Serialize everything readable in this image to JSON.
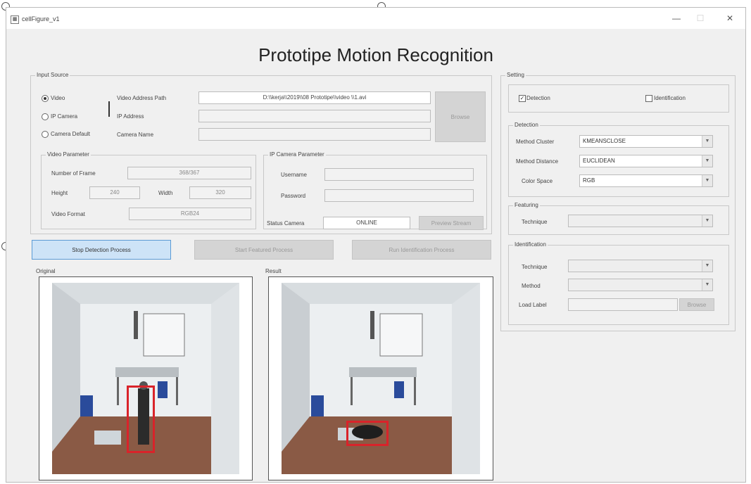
{
  "window": {
    "title": "cellFigure_v1",
    "minimize_icon": "minimize-icon",
    "maximize_icon": "maximize-icon",
    "close_icon": "close-icon"
  },
  "app_title": "Prototipe Motion Recognition",
  "input_source": {
    "title": "Input Source",
    "radios": [
      {
        "label": "Video",
        "checked": true
      },
      {
        "label": "IP Camera",
        "checked": false
      },
      {
        "label": "Camera Default",
        "checked": false
      }
    ],
    "video_path": {
      "label": "Video Address Path",
      "value": "D:\\\\kerja\\\\2019\\\\08 Prototipe\\\\video \\\\1.avi"
    },
    "ip_address": {
      "label": "IP Address",
      "value": ""
    },
    "camera_name": {
      "label": "Camera Name",
      "value": ""
    },
    "browse_label": "Browse"
  },
  "video_parameter": {
    "title": "Video Parameter",
    "frames": {
      "label": "Number of Frame",
      "value": "368/367"
    },
    "height": {
      "label": "Height",
      "value": "240"
    },
    "width": {
      "label": "Width",
      "value": "320"
    },
    "format": {
      "label": "Video Format",
      "value": "RGB24"
    }
  },
  "ip_camera_parameter": {
    "title": "IP Camera Parameter",
    "username": {
      "label": "Username",
      "value": ""
    },
    "password": {
      "label": "Password",
      "value": ""
    },
    "status": {
      "label": "Status Camera",
      "value": "ONLINE"
    },
    "preview_label": "Preview Stream"
  },
  "actions": {
    "detection": "Stop Detection Process",
    "feature": "Start Featured Process",
    "identification": "Run Identification Process"
  },
  "panels": {
    "original": "Original",
    "result": "Result"
  },
  "setting": {
    "title": "Setting",
    "detection_check": {
      "label": "Detection",
      "checked": true
    },
    "identification_check": {
      "label": "Identification",
      "checked": false
    },
    "detection_group": {
      "title": "Detection",
      "method_cluster": {
        "label": "Method Cluster",
        "value": "KMEANSCLOSE"
      },
      "method_distance": {
        "label": "Method Distance",
        "value": "EUCLIDEAN"
      },
      "color_space": {
        "label": "Color Space",
        "value": "RGB"
      }
    },
    "featuring_group": {
      "title": "Featuring",
      "technique": {
        "label": "Technique",
        "value": ""
      }
    },
    "identification_group": {
      "title": "Identification",
      "technique": {
        "label": "Technique",
        "value": ""
      },
      "method": {
        "label": "Method",
        "value": ""
      },
      "load_label": {
        "label": "Load Label",
        "value": "",
        "button": "Browse"
      }
    }
  },
  "colors": {
    "accent": "#5b9bd5",
    "detection_box": "#d9232a",
    "window_bg": "#f0f0f0"
  }
}
